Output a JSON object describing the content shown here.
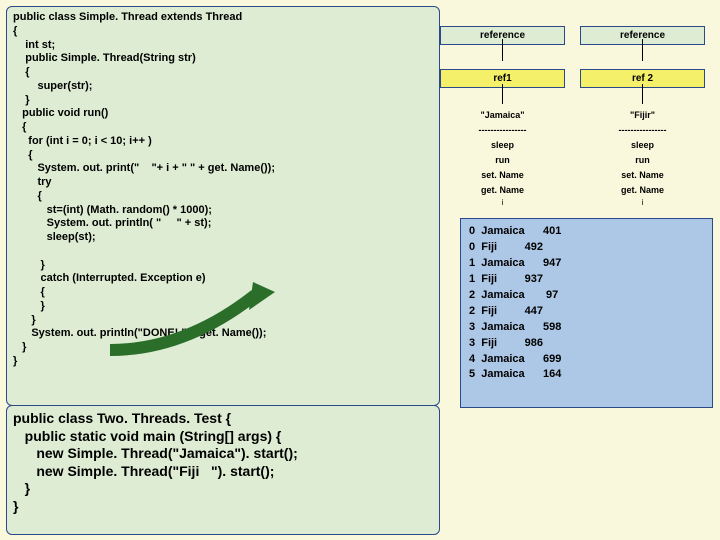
{
  "code_top": "public class Simple. Thread extends Thread\n{\n    int st;\n    public Simple. Thread(String str)\n    {\n        super(str);\n    }\n   public void run()\n   {\n     for (int i = 0; i < 10; i++ )\n     {\n        System. out. print(\"    \"+ i + \" \" + get. Name());\n        try\n        {\n           st=(int) (Math. random() * 1000);\n           System. out. println( \"     \" + st);\n           sleep(st);\n\n         }\n         catch (Interrupted. Exception e)\n         {\n         }\n      }\n      System. out. println(\"DONE! \" + get. Name());\n   }\n}",
  "code_bottom": "public class Two. Threads. Test {\n   public static void main (String[] args) {\n      new Simple. Thread(\"Jamaica\"). start();\n      new Simple. Thread(\"Fiji   \"). start();\n   }\n}",
  "ref1": {
    "reference": "reference",
    "name": "ref1",
    "string": "\"Jamaica\"",
    "dots": "----------------",
    "l1": "sleep",
    "l2": "run",
    "l3": "set. Name",
    "l4": "get. Name",
    "i": "i"
  },
  "ref2": {
    "reference": "reference",
    "name": "ref 2",
    "string": "\"Fijir\"",
    "dots": "----------------",
    "l1": "sleep",
    "l2": "run",
    "l3": "set. Name",
    "l4": "get. Name",
    "i": "i"
  },
  "output": "0  Jamaica      401\n0  Fiji         492\n1  Jamaica      947\n1  Fiji         937\n2  Jamaica       97\n2  Fiji         447\n3  Jamaica      598\n3  Fiji         986\n4  Jamaica      699\n5  Jamaica      164"
}
